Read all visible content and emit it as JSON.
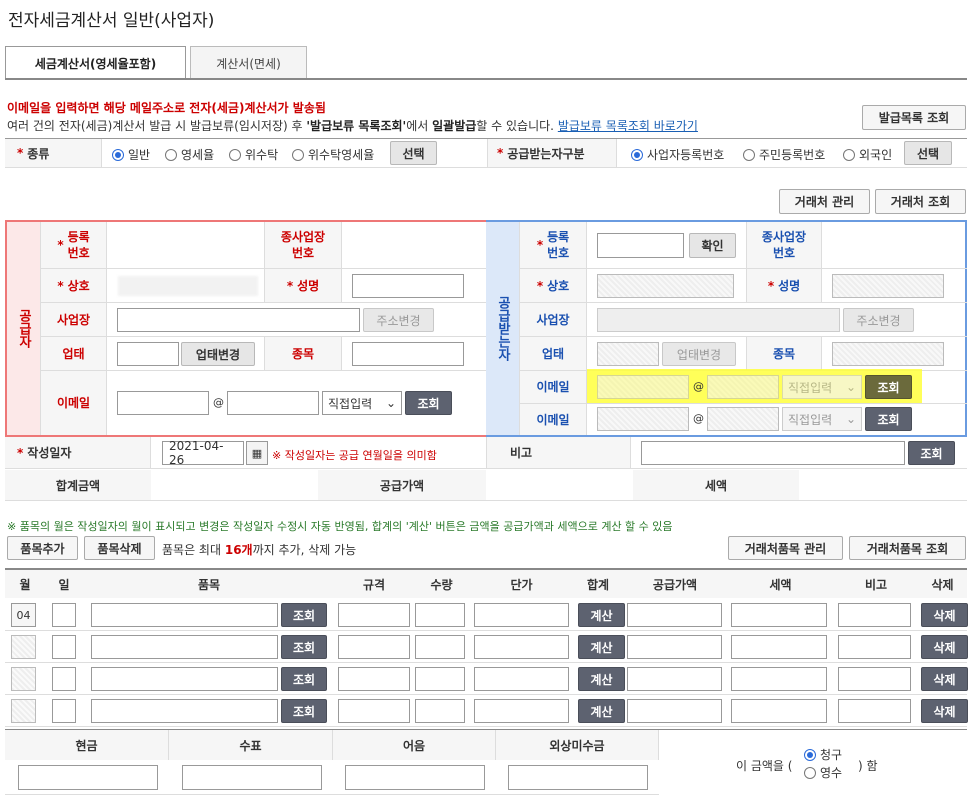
{
  "page_title": "전자세금계산서 일반(사업자)",
  "tabs": [
    {
      "label": "세금계산서(영세율포함)",
      "active": true
    },
    {
      "label": "계산서(면세)",
      "active": false
    }
  ],
  "notice": {
    "line1": "이메일을 입력하면 해당 메일주소로 전자(세금)계산서가 발송됨",
    "line2_pre": "여러 건의 전자(세금)계산서 발급 시 발급보류(임시저장) 후 ",
    "line2_bold1": "'발급보류 목록조회'",
    "line2_mid": "에서 ",
    "line2_bold2": "일괄발급",
    "line2_post": "할 수 있습니다.",
    "link": "발급보류 목록조회 바로가기"
  },
  "buttons": {
    "issue_list": "발급목록 조회",
    "select": "선택",
    "partner_manage": "거래처 관리",
    "partner_search": "거래처 조회",
    "confirm": "확인",
    "address_change": "주소변경",
    "biz_change": "업태변경",
    "search": "조회",
    "item_add": "품목추가",
    "item_delete": "품목삭제",
    "partner_item_manage": "거래처품목 관리",
    "partner_item_search": "거래처품목 조회",
    "calc": "계산",
    "delete": "삭제"
  },
  "type_row": {
    "label": "종류",
    "options": [
      "일반",
      "영세율",
      "위수탁",
      "위수탁영세율"
    ],
    "selected": "일반"
  },
  "receiver_type": {
    "label": "공급받는자구분",
    "options": [
      "사업자등록번호",
      "주민등록번호",
      "외국인"
    ],
    "selected": "사업자등록번호"
  },
  "supplier": {
    "side_label": "공급자",
    "reg_no": "등록\n번호",
    "sub_biz_no": "종사업장\n번호",
    "company": "상호",
    "name": "성명",
    "address": "사업장",
    "biz_type": "업태",
    "item": "종목",
    "email": "이메일",
    "email_domain_select": "직접입력"
  },
  "receiver": {
    "side_label": "공급받는자",
    "reg_no": "등록\n번호",
    "sub_biz_no": "종사업장\n번호",
    "company": "상호",
    "name": "성명",
    "address": "사업장",
    "biz_type": "업태",
    "item": "종목",
    "email1": "이메일",
    "email2": "이메일",
    "email_domain_select": "직접입력"
  },
  "date_row": {
    "label": "작성일자",
    "value": "2021-04-26",
    "hint": "※ 작성일자는 공급 연월일을 의미함",
    "remark": "비고"
  },
  "total_row": {
    "total": "합계금액",
    "supply": "공급가액",
    "tax": "세액"
  },
  "item_note": "※ 품목의 월은 작성일자의 월이 표시되고 변경은 작성일자 수정시 자동 반영됨, 합계의 '계산' 버튼은 금액을 공급가액과 세액으로 계산 할 수 있음",
  "item_limit": {
    "pre": "품목은 최대 ",
    "count": "16개",
    "post": "까지 추가, 삭제 가능"
  },
  "item_table": {
    "headers": [
      "월",
      "일",
      "품목",
      "규격",
      "수량",
      "단가",
      "합계",
      "공급가액",
      "세액",
      "비고",
      "삭제"
    ],
    "first_month": "04"
  },
  "payment": {
    "headers": [
      "현금",
      "수표",
      "어음",
      "외상미수금"
    ],
    "prefix": "이 금액을 (",
    "options": [
      "청구",
      "영수"
    ],
    "selected": "청구",
    "suffix": ") 함"
  },
  "at_sign": "@",
  "highlight_color": "#ffff3c"
}
